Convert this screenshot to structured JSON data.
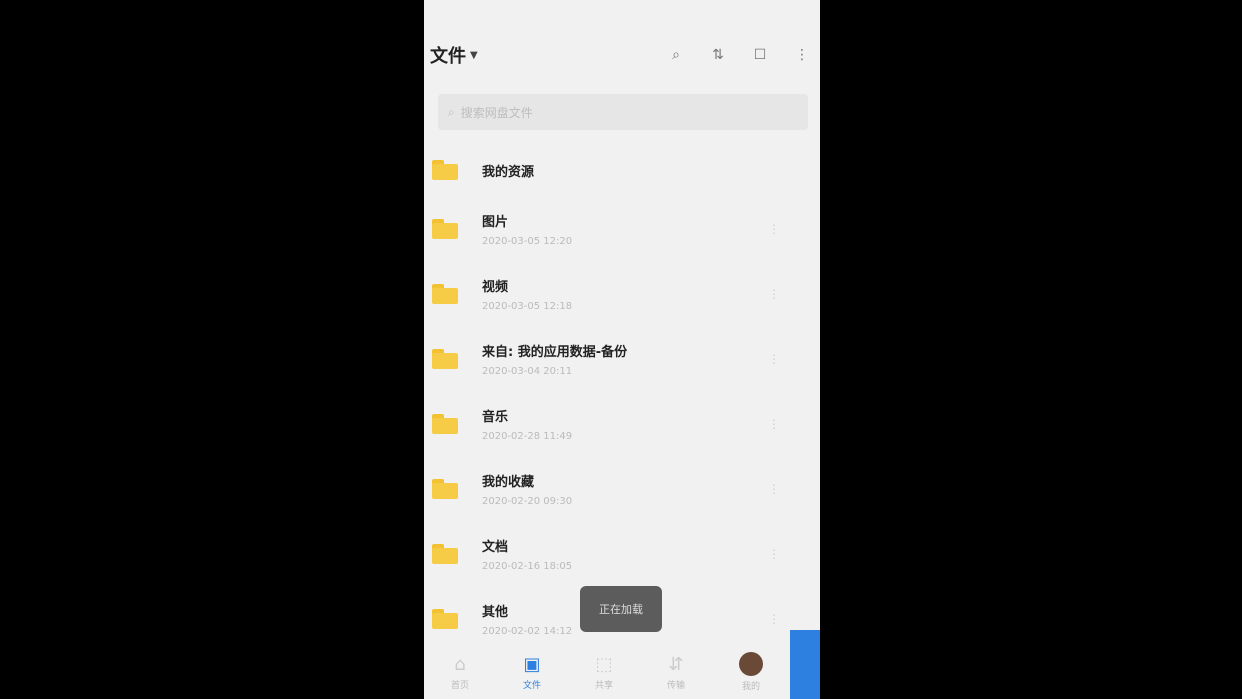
{
  "topbar": {
    "title": "文件",
    "icons": [
      "search-icon",
      "sort-icon",
      "select-icon",
      "more-icon"
    ]
  },
  "search": {
    "placeholder": "搜索网盘文件"
  },
  "folders": [
    {
      "name": "我的资源",
      "meta": ""
    },
    {
      "name": "图片",
      "meta": "2020-03-05 12:20"
    },
    {
      "name": "视频",
      "meta": "2020-03-05 12:18"
    },
    {
      "name": "来自: 我的应用数据-备份",
      "meta": "2020-03-04 20:11"
    },
    {
      "name": "音乐",
      "meta": "2020-02-28 11:49"
    },
    {
      "name": "我的收藏",
      "meta": "2020-02-20 09:30"
    },
    {
      "name": "文档",
      "meta": "2020-02-16 18:05"
    },
    {
      "name": "其他",
      "meta": "2020-02-02 14:12"
    }
  ],
  "toast": {
    "text": "正在加载"
  },
  "tabbar": {
    "items": [
      {
        "label": "首页",
        "icon": "home-icon"
      },
      {
        "label": "文件",
        "icon": "files-icon"
      },
      {
        "label": "共享",
        "icon": "share-icon"
      },
      {
        "label": "传输",
        "icon": "transfer-icon"
      },
      {
        "label": "我的",
        "icon": "avatar"
      }
    ]
  }
}
